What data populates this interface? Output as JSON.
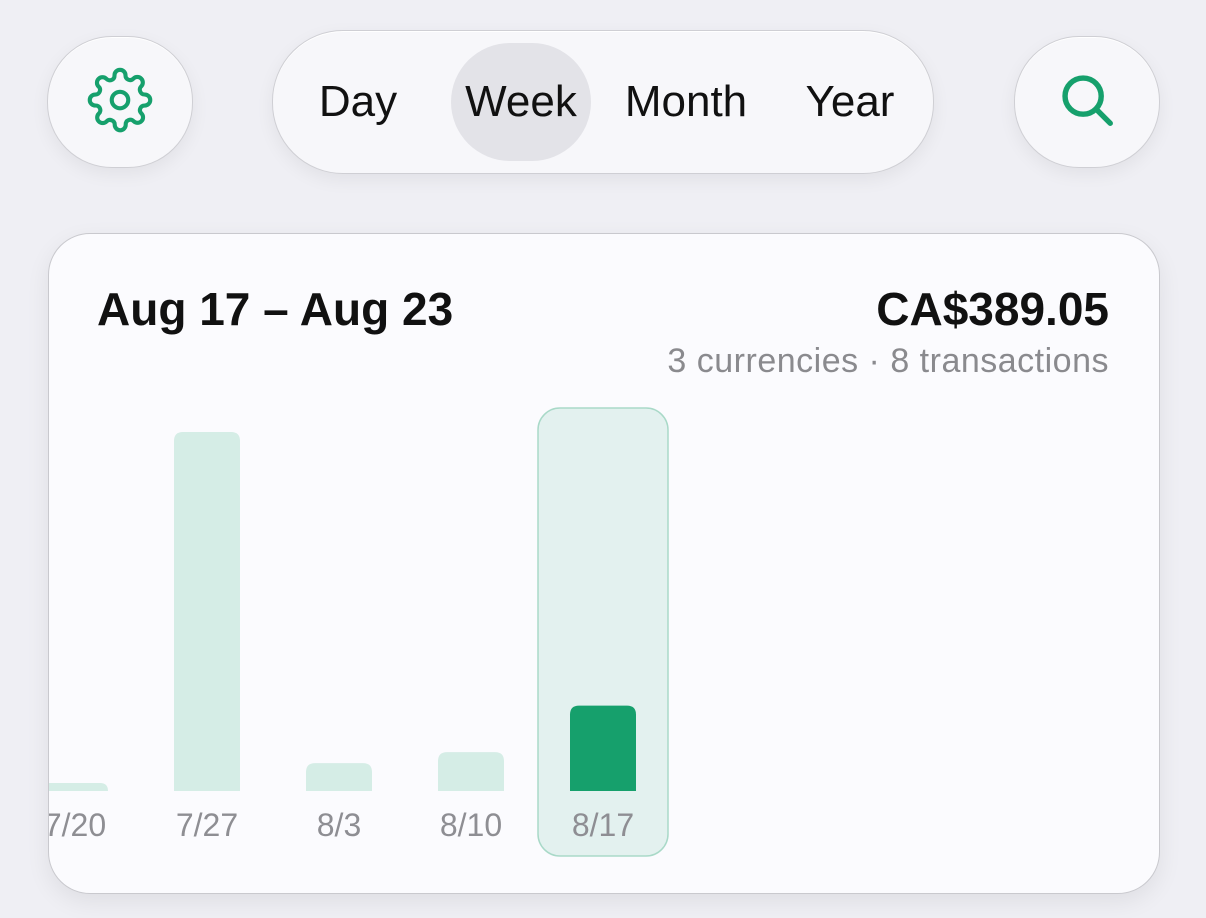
{
  "toolbar": {
    "settings_icon": "gear-icon",
    "search_icon": "search-icon",
    "accent_color": "#16a06c",
    "periods": [
      {
        "label": "Day",
        "selected": false
      },
      {
        "label": "Week",
        "selected": true
      },
      {
        "label": "Month",
        "selected": false
      },
      {
        "label": "Year",
        "selected": false
      }
    ]
  },
  "summary": {
    "date_range": "Aug 17 – Aug 23",
    "total": "CA$389.05",
    "subtitle": "3 currencies · 8 transactions"
  },
  "chart_data": {
    "type": "bar",
    "categories": [
      "7/20",
      "7/27",
      "8/3",
      "8/10",
      "8/17"
    ],
    "values": [
      17,
      1637,
      127,
      177,
      389.05
    ],
    "selected_category": "8/17",
    "bar_color": "#d5ede6",
    "selected_bar_color": "#16a06c",
    "selected_label_color": "#16a06c",
    "highlight_color": "#e3f1ef",
    "ylim": [
      0,
      1637
    ],
    "grid": false
  }
}
